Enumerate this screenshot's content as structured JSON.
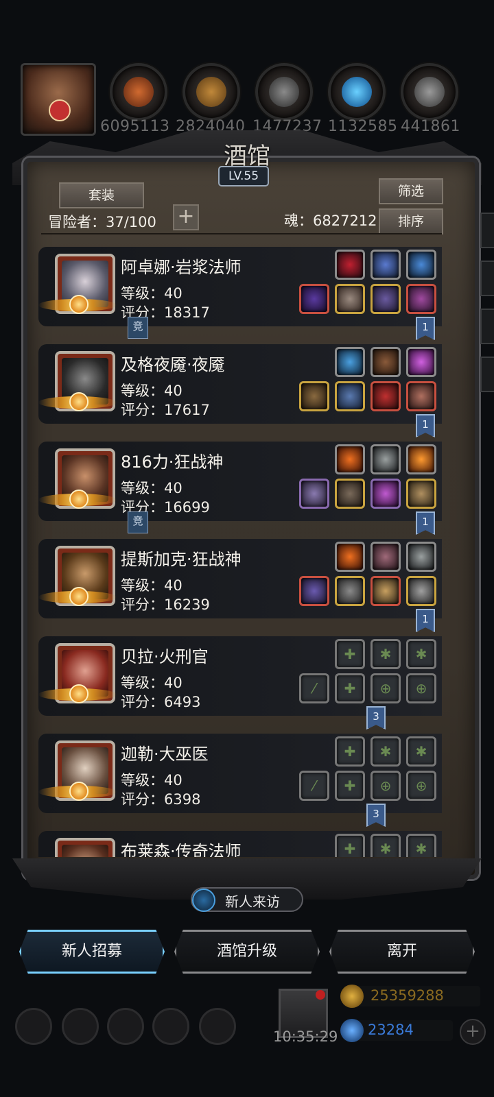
{
  "resources": {
    "values": [
      "6095113",
      "2824040",
      "1477237",
      "1132585",
      "441861"
    ]
  },
  "tavern": {
    "title": "酒馆",
    "level": "LV.55",
    "set_button": "套装",
    "filter_button": "筛选",
    "sort_button": "排序",
    "adventurers_label": "冒险者：37/100",
    "add_label": "+",
    "soul_label": "魂：6827212"
  },
  "heroes": [
    {
      "name": "阿卓娜·岩浆法师",
      "level": "等级：40",
      "score": "评分：18317",
      "badge": "1",
      "tag": "竞"
    },
    {
      "name": "及格夜魇·夜魇",
      "level": "等级：40",
      "score": "评分：17617",
      "badge": "1",
      "tag": ""
    },
    {
      "name": "816力·狂战神",
      "level": "等级：40",
      "score": "评分：16699",
      "badge": "1",
      "tag": "竞"
    },
    {
      "name": "提斯加克·狂战神",
      "level": "等级：40",
      "score": "评分：16239",
      "badge": "1",
      "tag": ""
    },
    {
      "name": "贝拉·火刑官",
      "level": "等级：40",
      "score": "评分：6493",
      "badge": "3",
      "tag": ""
    },
    {
      "name": "迦勒·大巫医",
      "level": "等级：40",
      "score": "评分：6398",
      "badge": "3",
      "tag": ""
    },
    {
      "name": "布莱森·传奇法师",
      "level": "",
      "score": "",
      "badge": "",
      "tag": ""
    }
  ],
  "buttons": {
    "visitor": "新人来访",
    "recruit": "新人招募",
    "upgrade": "酒馆升级",
    "leave": "离开"
  },
  "footer": {
    "clock": "10:35:29",
    "gold": "25359288",
    "gems": "23284",
    "add": "+"
  },
  "colors": {
    "accent_blue": "#4ab0ff",
    "gold_text": "#8a6a20",
    "gem_text": "#3a7ad8"
  }
}
